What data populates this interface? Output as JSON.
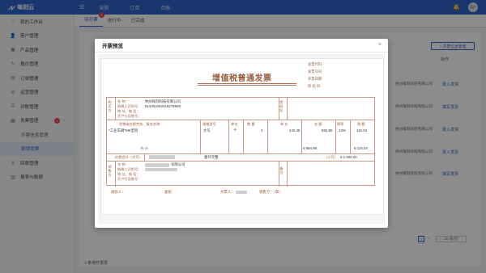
{
  "app": {
    "name": "每刻云"
  },
  "top_nav": [
    "采购",
    "订单",
    "合账"
  ],
  "avatar_text": "用户",
  "sidebar": {
    "items": [
      {
        "label": "我的工作台",
        "icon": "home-icon",
        "sub": false
      },
      {
        "label": "客户管理",
        "icon": "user-icon",
        "sub": false
      },
      {
        "label": "产品管理",
        "icon": "box-icon",
        "sub": false
      },
      {
        "label": "报价管理",
        "icon": "quote-icon",
        "sub": false
      },
      {
        "label": "订单管理",
        "icon": "cart-icon",
        "sub": false
      },
      {
        "label": "运营管理",
        "icon": "gear-icon",
        "sub": false
      },
      {
        "label": "对账管理",
        "icon": "ledger-icon",
        "sub": false
      },
      {
        "label": "发票管理",
        "icon": "invoice-icon",
        "sub": false,
        "badge": "1"
      },
      {
        "label": "开票信息管理",
        "icon": "",
        "sub": true
      },
      {
        "label": "销项发票",
        "icon": "",
        "sub": true,
        "active": true
      },
      {
        "label": "回款管理",
        "icon": "money-icon",
        "sub": false
      },
      {
        "label": "报表与数据",
        "icon": "chart-icon",
        "sub": false
      }
    ]
  },
  "tabs": [
    {
      "label": "待开票",
      "badge": "1",
      "active": true
    },
    {
      "label": "进行中",
      "active": false
    },
    {
      "label": "已完成",
      "active": false
    }
  ],
  "list": {
    "new_button": "+ 开票信息管理",
    "op_header": "操作",
    "rows": [
      {
        "company": "杭州每刻科技有限公司",
        "action": "录入发票"
      },
      {
        "company": "杭州每刻科技有限公司",
        "action": "填写发票"
      },
      {
        "company": "杭州每刻科技有限公司",
        "action": "录入发票"
      },
      {
        "company": "杭州每刻科技有限公司",
        "action": "录入发票"
      },
      {
        "company": "杭州每刻科技有限公司",
        "action": "填写发票"
      }
    ],
    "page": "1",
    "page_size": "20 条/页",
    "footer": "1 条待开发票"
  },
  "modal": {
    "title": "开票预览",
    "close": "×"
  },
  "invoice": {
    "title": "增值税普通发票",
    "meta": [
      "发票代码",
      "发票号码",
      "开票日期",
      "校 验 码"
    ],
    "buyer_label": "购买方",
    "buyer_fields": [
      "名 称：",
      "纳税人识别号：",
      "地 址、电 话：",
      "开户行及账号："
    ],
    "buyer_name": "杭州每刻科技有限公司",
    "buyer_tax_id": "91330106341827699X",
    "password_area": "密码区",
    "headers": {
      "goods": "货物或应税劳务、服务名称",
      "spec": "规格型号",
      "unit": "单位",
      "qty": "数 量",
      "price": "单 价",
      "amount": "金 额",
      "rate": "税率",
      "tax": "税 额"
    },
    "item": {
      "goods": "*工业车辆*MK型别",
      "spec": "大号",
      "unit": "个",
      "qty": "2",
      "price": "442.48",
      "amount": "884.96",
      "rate": "13%",
      "tax": "115.04"
    },
    "total_label": "合 计",
    "total_amount": "¥ 884.96",
    "total_tax": "¥ 115.04",
    "grand_label": "价税合计（大写）",
    "grand_words": "壹仟元整",
    "grand_small_label": "（小写）",
    "grand_small": "¥ 1,000.00",
    "seller_label": "销售方",
    "seller_fields": [
      "名 称：",
      "纳税人识别号：",
      "地 址、电 话：",
      "开户行及账号："
    ],
    "seller_name_suffix": "有限公司",
    "remark_label": "备 注",
    "signatures": [
      "收款人：",
      "复核：",
      "开票人：",
      "销售方：（章）"
    ]
  }
}
